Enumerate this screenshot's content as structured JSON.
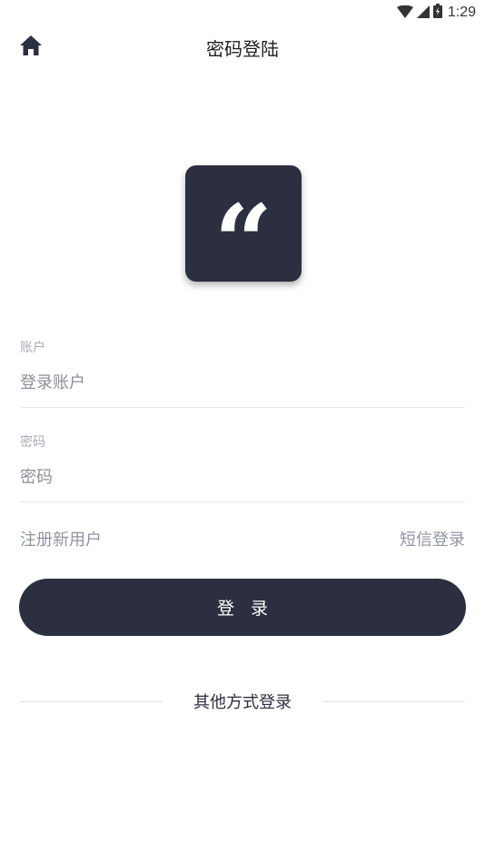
{
  "status_bar": {
    "time": "1:29",
    "icons": [
      "wifi-icon",
      "signal-icon",
      "battery-icon"
    ]
  },
  "header": {
    "home_icon": "home-icon",
    "title": "密码登陆"
  },
  "logo": {
    "mark": "“",
    "icon": "quote-logo-icon"
  },
  "form": {
    "account": {
      "label": "账户",
      "placeholder": "登录账户",
      "value": ""
    },
    "password": {
      "label": "密码",
      "placeholder": "密码",
      "value": ""
    }
  },
  "links": {
    "register": "注册新用户",
    "sms_login": "短信登录"
  },
  "login_button": "登 录",
  "other_login": "其他方式登录",
  "colors": {
    "primary": "#2b2f3f",
    "label": "#a7acb5",
    "link": "#8f95a1",
    "divider": "#e8e9ec"
  }
}
